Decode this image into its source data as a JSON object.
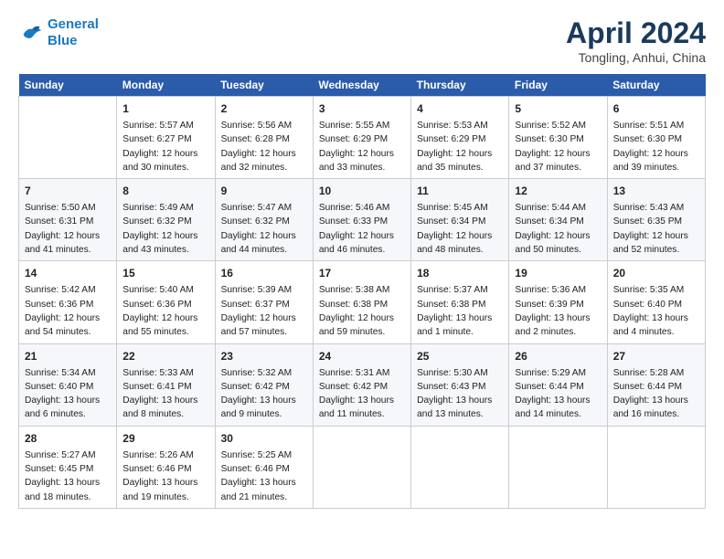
{
  "header": {
    "logo_line1": "General",
    "logo_line2": "Blue",
    "title": "April 2024",
    "subtitle": "Tongling, Anhui, China"
  },
  "columns": [
    "Sunday",
    "Monday",
    "Tuesday",
    "Wednesday",
    "Thursday",
    "Friday",
    "Saturday"
  ],
  "rows": [
    [
      {
        "day": "",
        "lines": []
      },
      {
        "day": "1",
        "lines": [
          "Sunrise: 5:57 AM",
          "Sunset: 6:27 PM",
          "Daylight: 12 hours",
          "and 30 minutes."
        ]
      },
      {
        "day": "2",
        "lines": [
          "Sunrise: 5:56 AM",
          "Sunset: 6:28 PM",
          "Daylight: 12 hours",
          "and 32 minutes."
        ]
      },
      {
        "day": "3",
        "lines": [
          "Sunrise: 5:55 AM",
          "Sunset: 6:29 PM",
          "Daylight: 12 hours",
          "and 33 minutes."
        ]
      },
      {
        "day": "4",
        "lines": [
          "Sunrise: 5:53 AM",
          "Sunset: 6:29 PM",
          "Daylight: 12 hours",
          "and 35 minutes."
        ]
      },
      {
        "day": "5",
        "lines": [
          "Sunrise: 5:52 AM",
          "Sunset: 6:30 PM",
          "Daylight: 12 hours",
          "and 37 minutes."
        ]
      },
      {
        "day": "6",
        "lines": [
          "Sunrise: 5:51 AM",
          "Sunset: 6:30 PM",
          "Daylight: 12 hours",
          "and 39 minutes."
        ]
      }
    ],
    [
      {
        "day": "7",
        "lines": [
          "Sunrise: 5:50 AM",
          "Sunset: 6:31 PM",
          "Daylight: 12 hours",
          "and 41 minutes."
        ]
      },
      {
        "day": "8",
        "lines": [
          "Sunrise: 5:49 AM",
          "Sunset: 6:32 PM",
          "Daylight: 12 hours",
          "and 43 minutes."
        ]
      },
      {
        "day": "9",
        "lines": [
          "Sunrise: 5:47 AM",
          "Sunset: 6:32 PM",
          "Daylight: 12 hours",
          "and 44 minutes."
        ]
      },
      {
        "day": "10",
        "lines": [
          "Sunrise: 5:46 AM",
          "Sunset: 6:33 PM",
          "Daylight: 12 hours",
          "and 46 minutes."
        ]
      },
      {
        "day": "11",
        "lines": [
          "Sunrise: 5:45 AM",
          "Sunset: 6:34 PM",
          "Daylight: 12 hours",
          "and 48 minutes."
        ]
      },
      {
        "day": "12",
        "lines": [
          "Sunrise: 5:44 AM",
          "Sunset: 6:34 PM",
          "Daylight: 12 hours",
          "and 50 minutes."
        ]
      },
      {
        "day": "13",
        "lines": [
          "Sunrise: 5:43 AM",
          "Sunset: 6:35 PM",
          "Daylight: 12 hours",
          "and 52 minutes."
        ]
      }
    ],
    [
      {
        "day": "14",
        "lines": [
          "Sunrise: 5:42 AM",
          "Sunset: 6:36 PM",
          "Daylight: 12 hours",
          "and 54 minutes."
        ]
      },
      {
        "day": "15",
        "lines": [
          "Sunrise: 5:40 AM",
          "Sunset: 6:36 PM",
          "Daylight: 12 hours",
          "and 55 minutes."
        ]
      },
      {
        "day": "16",
        "lines": [
          "Sunrise: 5:39 AM",
          "Sunset: 6:37 PM",
          "Daylight: 12 hours",
          "and 57 minutes."
        ]
      },
      {
        "day": "17",
        "lines": [
          "Sunrise: 5:38 AM",
          "Sunset: 6:38 PM",
          "Daylight: 12 hours",
          "and 59 minutes."
        ]
      },
      {
        "day": "18",
        "lines": [
          "Sunrise: 5:37 AM",
          "Sunset: 6:38 PM",
          "Daylight: 13 hours",
          "and 1 minute."
        ]
      },
      {
        "day": "19",
        "lines": [
          "Sunrise: 5:36 AM",
          "Sunset: 6:39 PM",
          "Daylight: 13 hours",
          "and 2 minutes."
        ]
      },
      {
        "day": "20",
        "lines": [
          "Sunrise: 5:35 AM",
          "Sunset: 6:40 PM",
          "Daylight: 13 hours",
          "and 4 minutes."
        ]
      }
    ],
    [
      {
        "day": "21",
        "lines": [
          "Sunrise: 5:34 AM",
          "Sunset: 6:40 PM",
          "Daylight: 13 hours",
          "and 6 minutes."
        ]
      },
      {
        "day": "22",
        "lines": [
          "Sunrise: 5:33 AM",
          "Sunset: 6:41 PM",
          "Daylight: 13 hours",
          "and 8 minutes."
        ]
      },
      {
        "day": "23",
        "lines": [
          "Sunrise: 5:32 AM",
          "Sunset: 6:42 PM",
          "Daylight: 13 hours",
          "and 9 minutes."
        ]
      },
      {
        "day": "24",
        "lines": [
          "Sunrise: 5:31 AM",
          "Sunset: 6:42 PM",
          "Daylight: 13 hours",
          "and 11 minutes."
        ]
      },
      {
        "day": "25",
        "lines": [
          "Sunrise: 5:30 AM",
          "Sunset: 6:43 PM",
          "Daylight: 13 hours",
          "and 13 minutes."
        ]
      },
      {
        "day": "26",
        "lines": [
          "Sunrise: 5:29 AM",
          "Sunset: 6:44 PM",
          "Daylight: 13 hours",
          "and 14 minutes."
        ]
      },
      {
        "day": "27",
        "lines": [
          "Sunrise: 5:28 AM",
          "Sunset: 6:44 PM",
          "Daylight: 13 hours",
          "and 16 minutes."
        ]
      }
    ],
    [
      {
        "day": "28",
        "lines": [
          "Sunrise: 5:27 AM",
          "Sunset: 6:45 PM",
          "Daylight: 13 hours",
          "and 18 minutes."
        ]
      },
      {
        "day": "29",
        "lines": [
          "Sunrise: 5:26 AM",
          "Sunset: 6:46 PM",
          "Daylight: 13 hours",
          "and 19 minutes."
        ]
      },
      {
        "day": "30",
        "lines": [
          "Sunrise: 5:25 AM",
          "Sunset: 6:46 PM",
          "Daylight: 13 hours",
          "and 21 minutes."
        ]
      },
      {
        "day": "",
        "lines": []
      },
      {
        "day": "",
        "lines": []
      },
      {
        "day": "",
        "lines": []
      },
      {
        "day": "",
        "lines": []
      }
    ]
  ]
}
